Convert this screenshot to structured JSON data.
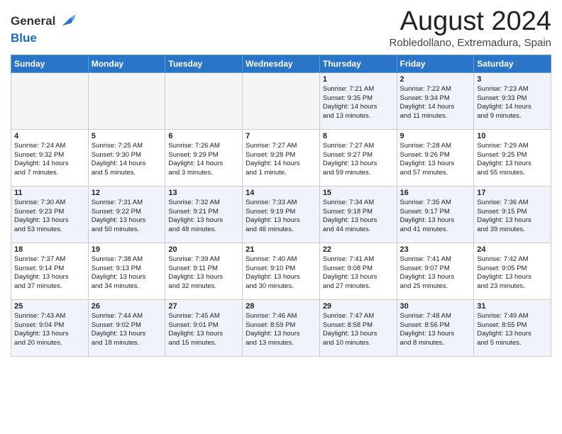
{
  "header": {
    "logo_line1": "General",
    "logo_line2": "Blue",
    "month_title": "August 2024",
    "location": "Robledollano, Extremadura, Spain"
  },
  "weekdays": [
    "Sunday",
    "Monday",
    "Tuesday",
    "Wednesday",
    "Thursday",
    "Friday",
    "Saturday"
  ],
  "weeks": [
    [
      {
        "day": "",
        "info": "",
        "empty": true
      },
      {
        "day": "",
        "info": "",
        "empty": true
      },
      {
        "day": "",
        "info": "",
        "empty": true
      },
      {
        "day": "",
        "info": "",
        "empty": true
      },
      {
        "day": "1",
        "info": "Sunrise: 7:21 AM\nSunset: 9:35 PM\nDaylight: 14 hours\nand 13 minutes.",
        "empty": false
      },
      {
        "day": "2",
        "info": "Sunrise: 7:22 AM\nSunset: 9:34 PM\nDaylight: 14 hours\nand 11 minutes.",
        "empty": false
      },
      {
        "day": "3",
        "info": "Sunrise: 7:23 AM\nSunset: 9:33 PM\nDaylight: 14 hours\nand 9 minutes.",
        "empty": false
      }
    ],
    [
      {
        "day": "4",
        "info": "Sunrise: 7:24 AM\nSunset: 9:32 PM\nDaylight: 14 hours\nand 7 minutes.",
        "empty": false
      },
      {
        "day": "5",
        "info": "Sunrise: 7:25 AM\nSunset: 9:30 PM\nDaylight: 14 hours\nand 5 minutes.",
        "empty": false
      },
      {
        "day": "6",
        "info": "Sunrise: 7:26 AM\nSunset: 9:29 PM\nDaylight: 14 hours\nand 3 minutes.",
        "empty": false
      },
      {
        "day": "7",
        "info": "Sunrise: 7:27 AM\nSunset: 9:28 PM\nDaylight: 14 hours\nand 1 minute.",
        "empty": false
      },
      {
        "day": "8",
        "info": "Sunrise: 7:27 AM\nSunset: 9:27 PM\nDaylight: 13 hours\nand 59 minutes.",
        "empty": false
      },
      {
        "day": "9",
        "info": "Sunrise: 7:28 AM\nSunset: 9:26 PM\nDaylight: 13 hours\nand 57 minutes.",
        "empty": false
      },
      {
        "day": "10",
        "info": "Sunrise: 7:29 AM\nSunset: 9:25 PM\nDaylight: 13 hours\nand 55 minutes.",
        "empty": false
      }
    ],
    [
      {
        "day": "11",
        "info": "Sunrise: 7:30 AM\nSunset: 9:23 PM\nDaylight: 13 hours\nand 53 minutes.",
        "empty": false
      },
      {
        "day": "12",
        "info": "Sunrise: 7:31 AM\nSunset: 9:22 PM\nDaylight: 13 hours\nand 50 minutes.",
        "empty": false
      },
      {
        "day": "13",
        "info": "Sunrise: 7:32 AM\nSunset: 9:21 PM\nDaylight: 13 hours\nand 48 minutes.",
        "empty": false
      },
      {
        "day": "14",
        "info": "Sunrise: 7:33 AM\nSunset: 9:19 PM\nDaylight: 13 hours\nand 46 minutes.",
        "empty": false
      },
      {
        "day": "15",
        "info": "Sunrise: 7:34 AM\nSunset: 9:18 PM\nDaylight: 13 hours\nand 44 minutes.",
        "empty": false
      },
      {
        "day": "16",
        "info": "Sunrise: 7:35 AM\nSunset: 9:17 PM\nDaylight: 13 hours\nand 41 minutes.",
        "empty": false
      },
      {
        "day": "17",
        "info": "Sunrise: 7:36 AM\nSunset: 9:15 PM\nDaylight: 13 hours\nand 39 minutes.",
        "empty": false
      }
    ],
    [
      {
        "day": "18",
        "info": "Sunrise: 7:37 AM\nSunset: 9:14 PM\nDaylight: 13 hours\nand 37 minutes.",
        "empty": false
      },
      {
        "day": "19",
        "info": "Sunrise: 7:38 AM\nSunset: 9:13 PM\nDaylight: 13 hours\nand 34 minutes.",
        "empty": false
      },
      {
        "day": "20",
        "info": "Sunrise: 7:39 AM\nSunset: 9:11 PM\nDaylight: 13 hours\nand 32 minutes.",
        "empty": false
      },
      {
        "day": "21",
        "info": "Sunrise: 7:40 AM\nSunset: 9:10 PM\nDaylight: 13 hours\nand 30 minutes.",
        "empty": false
      },
      {
        "day": "22",
        "info": "Sunrise: 7:41 AM\nSunset: 9:08 PM\nDaylight: 13 hours\nand 27 minutes.",
        "empty": false
      },
      {
        "day": "23",
        "info": "Sunrise: 7:41 AM\nSunset: 9:07 PM\nDaylight: 13 hours\nand 25 minutes.",
        "empty": false
      },
      {
        "day": "24",
        "info": "Sunrise: 7:42 AM\nSunset: 9:05 PM\nDaylight: 13 hours\nand 23 minutes.",
        "empty": false
      }
    ],
    [
      {
        "day": "25",
        "info": "Sunrise: 7:43 AM\nSunset: 9:04 PM\nDaylight: 13 hours\nand 20 minutes.",
        "empty": false
      },
      {
        "day": "26",
        "info": "Sunrise: 7:44 AM\nSunset: 9:02 PM\nDaylight: 13 hours\nand 18 minutes.",
        "empty": false
      },
      {
        "day": "27",
        "info": "Sunrise: 7:45 AM\nSunset: 9:01 PM\nDaylight: 13 hours\nand 15 minutes.",
        "empty": false
      },
      {
        "day": "28",
        "info": "Sunrise: 7:46 AM\nSunset: 8:59 PM\nDaylight: 13 hours\nand 13 minutes.",
        "empty": false
      },
      {
        "day": "29",
        "info": "Sunrise: 7:47 AM\nSunset: 8:58 PM\nDaylight: 13 hours\nand 10 minutes.",
        "empty": false
      },
      {
        "day": "30",
        "info": "Sunrise: 7:48 AM\nSunset: 8:56 PM\nDaylight: 13 hours\nand 8 minutes.",
        "empty": false
      },
      {
        "day": "31",
        "info": "Sunrise: 7:49 AM\nSunset: 8:55 PM\nDaylight: 13 hours\nand 5 minutes.",
        "empty": false
      }
    ]
  ]
}
